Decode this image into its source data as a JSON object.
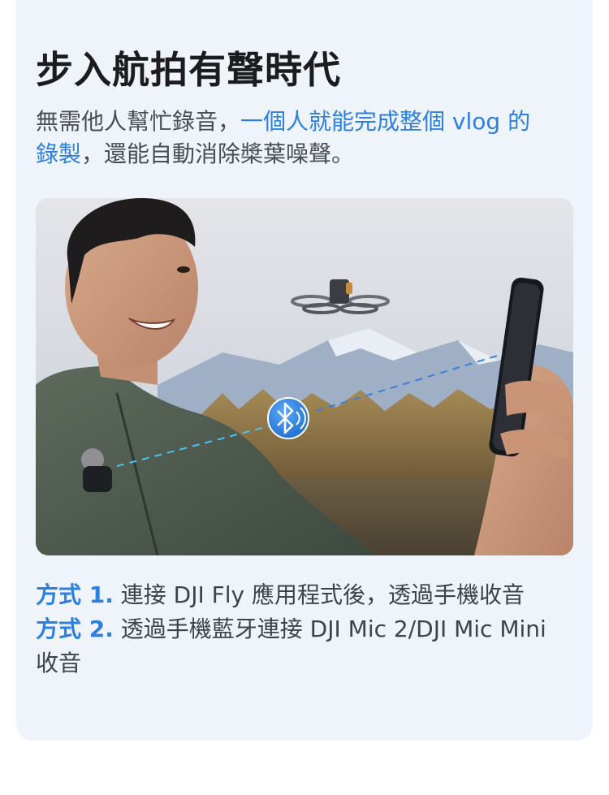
{
  "title": "步入航拍有聲時代",
  "intro": {
    "part1": "無需他人幫忙錄音，",
    "highlight_a": "一個人就能完成整個 vlog 的",
    "highlight_b": "錄製",
    "part2": "，還能自動消除槳葉噪聲。"
  },
  "photo": {
    "bluetooth_icon": "bluetooth-audio-icon"
  },
  "methods": [
    {
      "label": "方式 1.",
      "text": "連接 DJI Fly 應用程式後，透過手機收音"
    },
    {
      "label": "方式 2.",
      "text": "透過手機藍牙連接 DJI Mic 2/DJI Mic Mini",
      "text_cont": "收音"
    }
  ],
  "colors": {
    "accent": "#2d7fe0",
    "card_bg": "#eef4fa",
    "title": "#1c1c1e",
    "body": "#4a4d52"
  }
}
